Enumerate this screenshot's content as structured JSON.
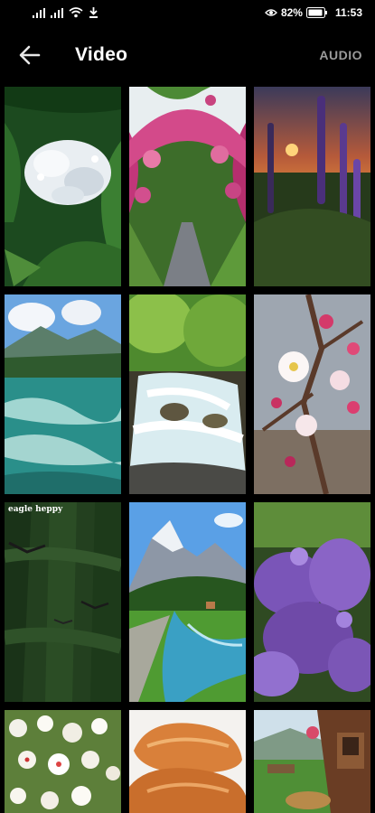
{
  "status_bar": {
    "battery_percent": "82%",
    "time": "11:53",
    "icons": [
      "signal-icon",
      "signal-icon",
      "wifi-icon",
      "download-icon",
      "eye-icon",
      "battery-icon"
    ]
  },
  "header": {
    "title": "Video",
    "back_icon": "arrow-left-icon",
    "audio_label": "AUDIO"
  },
  "videos": [
    {
      "scene": "white flowers with green leaves"
    },
    {
      "scene": "garden path under pink rose arch"
    },
    {
      "scene": "purple lupins at sunset"
    },
    {
      "scene": "mountain river under blue sky"
    },
    {
      "scene": "waterfall in green forest"
    },
    {
      "scene": "white and pink blossoms on branch"
    },
    {
      "scene": "birds flying over forest",
      "caption": "eagle heppy"
    },
    {
      "scene": "alpine stream with snowy mountain"
    },
    {
      "scene": "purple lilac flowers"
    },
    {
      "scene": "white blossom tree"
    },
    {
      "scene": "bread loaves"
    },
    {
      "scene": "garden with wooden house"
    }
  ],
  "colors": {
    "background": "#000000",
    "audio_label": "#9b9b9b"
  }
}
